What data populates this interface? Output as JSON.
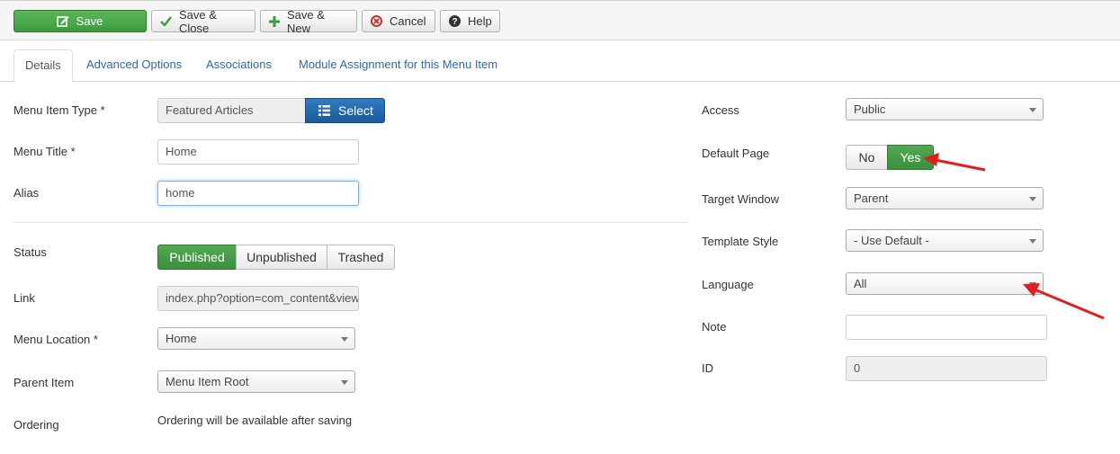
{
  "toolbar": {
    "save": "Save",
    "save_close": "Save & Close",
    "save_new": "Save & New",
    "cancel": "Cancel",
    "help": "Help"
  },
  "tabs": [
    "Details",
    "Advanced Options",
    "Associations",
    "Module Assignment for this Menu Item"
  ],
  "left": {
    "menu_item_type": {
      "label": "Menu Item Type *",
      "value": "Featured Articles",
      "button": "Select"
    },
    "menu_title": {
      "label": "Menu Title *",
      "value": "Home"
    },
    "alias": {
      "label": "Alias",
      "value": "home"
    },
    "status": {
      "label": "Status",
      "options": [
        "Published",
        "Unpublished",
        "Trashed"
      ],
      "selected": "Published"
    },
    "link": {
      "label": "Link",
      "value": "index.php?option=com_content&view=featured"
    },
    "menu_location": {
      "label": "Menu Location *",
      "value": "Home"
    },
    "parent_item": {
      "label": "Parent Item",
      "value": "Menu Item Root"
    },
    "ordering": {
      "label": "Ordering",
      "value": "Ordering will be available after saving"
    }
  },
  "right": {
    "access": {
      "label": "Access",
      "value": "Public"
    },
    "default_page": {
      "label": "Default Page",
      "no": "No",
      "yes": "Yes",
      "selected": "Yes"
    },
    "target_window": {
      "label": "Target Window",
      "value": "Parent"
    },
    "template_style": {
      "label": "Template Style",
      "value": "- Use Default -"
    },
    "language": {
      "label": "Language",
      "value": "All"
    },
    "note": {
      "label": "Note",
      "value": ""
    },
    "id": {
      "label": "ID",
      "value": "0"
    }
  },
  "colors": {
    "green": "#46a546",
    "blue": "#2a69b8",
    "annotation_red": "#e02020"
  }
}
